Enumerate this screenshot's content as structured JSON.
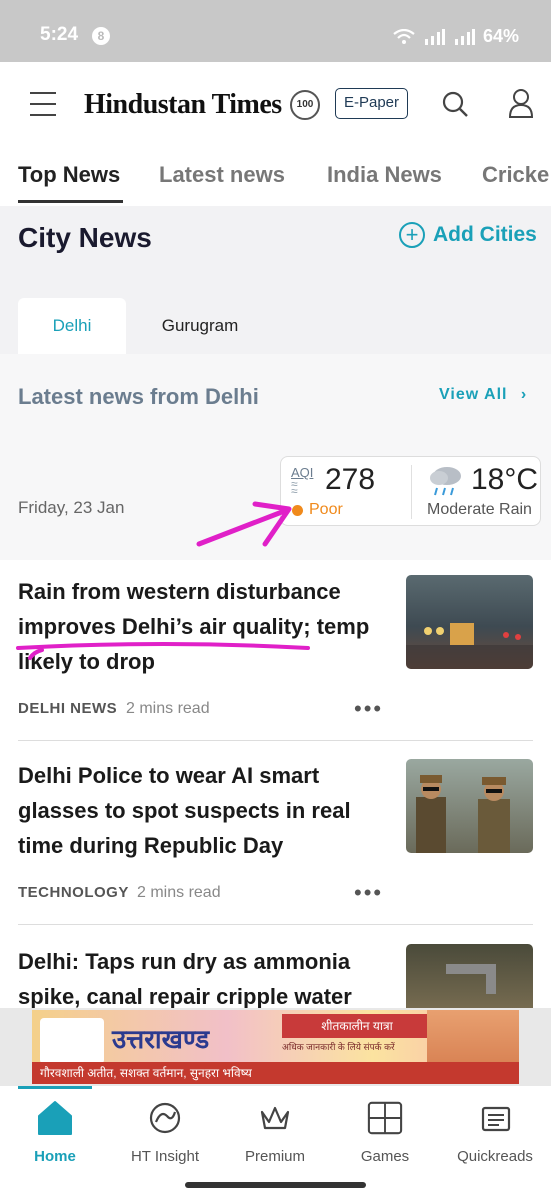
{
  "status_bar": {
    "time": "5:24",
    "notification_badge": "8",
    "battery": "64%"
  },
  "header": {
    "logo_text": "Hindustan Times",
    "logo_badge": "100",
    "epaper_label": "E-Paper"
  },
  "tabs": [
    {
      "label": "Top News",
      "active": true
    },
    {
      "label": "Latest news",
      "active": false
    },
    {
      "label": "India News",
      "active": false
    },
    {
      "label": "Cricke",
      "active": false
    }
  ],
  "city_news": {
    "title": "City News",
    "add_cities_label": "Add Cities",
    "city_tabs": [
      {
        "label": "Delhi",
        "active": true
      },
      {
        "label": "Gurugram",
        "active": false
      }
    ],
    "latest_title": "Latest news from Delhi",
    "view_all_label": "View All",
    "date": "Friday, 23 Jan",
    "aqi": {
      "label": "AQI",
      "value": "278",
      "status": "Poor",
      "status_color": "#f08a1c"
    },
    "weather": {
      "temperature": "18°C",
      "condition": "Moderate Rain"
    }
  },
  "articles": [
    {
      "title": "Rain from western disturbance improves Delhi’s air quality; temp likely to drop",
      "category": "DELHI NEWS",
      "read_time": "2 mins read",
      "thumbnail": "rainy-street-photo"
    },
    {
      "title": "Delhi Police to wear AI smart glasses to spot suspects in real time during Republic Day",
      "category": "TECHNOLOGY",
      "read_time": "2 mins read",
      "thumbnail": "police-officers-photo"
    },
    {
      "title": "Delhi: Taps run dry as ammonia spike, canal repair cripple water",
      "category": "",
      "read_time": "",
      "thumbnail": "water-tap-photo"
    }
  ],
  "ad": {
    "brand": "उत्तराखण्ड",
    "headline": "शीतकालीन यात्रा",
    "subline": "अधिक जानकारी के लिये संपर्क करें",
    "tagline": "गौरवशाली अतीत, सशक्त वर्तमान, सुनहरा भविष्य"
  },
  "bottom_nav": [
    {
      "label": "Home",
      "icon": "home-icon",
      "active": true
    },
    {
      "label": "HT Insight",
      "icon": "insight-icon",
      "active": false
    },
    {
      "label": "Premium",
      "icon": "crown-icon",
      "active": false
    },
    {
      "label": "Games",
      "icon": "puzzle-icon",
      "active": false
    },
    {
      "label": "Quickreads",
      "icon": "quickreads-icon",
      "active": false
    }
  ],
  "colors": {
    "accent": "#1aa0b8",
    "annotation": "#e020c8"
  }
}
